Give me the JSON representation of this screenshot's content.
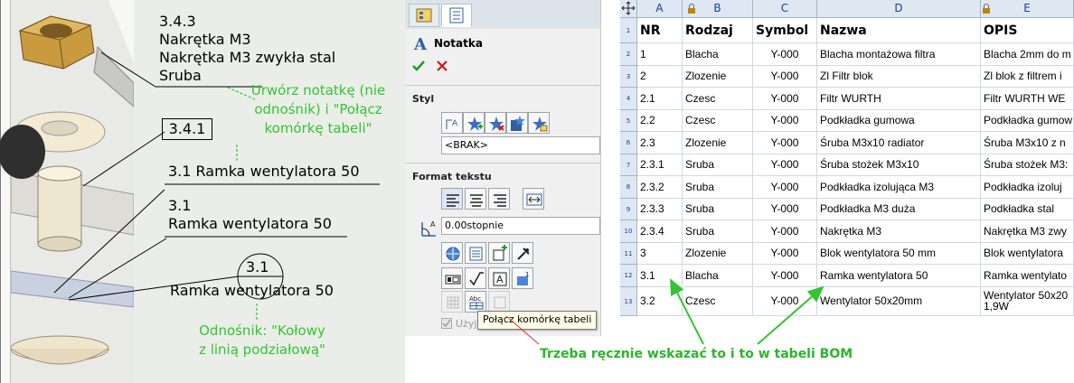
{
  "drawing": {
    "note1": {
      "line1": "3.4.3",
      "line2": "Nakrętka M3",
      "line3": "Nakrętka M3 zwykła stal",
      "line4": "Sruba"
    },
    "callout_note": {
      "line1": "Urwórz notatkę (nie",
      "line2": "odnośnik) i \"Połącz",
      "line3": "komórkę tabeli\""
    },
    "balloon_box": "3.4.1",
    "note2": "3.1  Ramka wentylatora 50",
    "note3": {
      "line1": "3.1",
      "line2": "Ramka wentylatora 50"
    },
    "balloon_circle": {
      "top": "3.1",
      "bottom": "Ramka wentylatora 50"
    },
    "callout_balloon": {
      "line1": "Odnośnik: \"Kołowy",
      "line2": "z linią podziałową\""
    }
  },
  "panel": {
    "title": "Notatka",
    "style_section": "Styl",
    "style_value": "<BRAK>",
    "text_format_section": "Format tekstu",
    "angle_value": "0.00stopnie",
    "checkbox_label": "Użyj czcionki dokumentu",
    "tooltip": "Połącz komórkę tabeli"
  },
  "sheet": {
    "columns": [
      "A",
      "B",
      "C",
      "D",
      "E"
    ],
    "header_row": [
      "NR",
      "Rodzaj",
      "Symbol",
      "Nazwa",
      "OPIS"
    ],
    "rows": [
      {
        "num": "2",
        "cells": [
          "1",
          "Blacha",
          "Y-000",
          "Blacha montażowa filtra",
          "Blacha 2mm do m"
        ]
      },
      {
        "num": "3",
        "cells": [
          "2",
          "Zlozenie",
          "Y-000",
          "Zl Filtr blok",
          "Zl blok z filtrem i"
        ]
      },
      {
        "num": "4",
        "cells": [
          "2.1",
          "Czesc",
          "Y-000",
          "Filtr WURTH",
          "Filtr WURTH WE"
        ]
      },
      {
        "num": "5",
        "cells": [
          "2.2",
          "Czesc",
          "Y-000",
          "Podkładka gumowa",
          "Podkładka gumow"
        ]
      },
      {
        "num": "6",
        "cells": [
          "2.3",
          "Zlozenie",
          "Y-000",
          "Śruba M3x10 radiator",
          "Śruba M3x10 z n"
        ]
      },
      {
        "num": "7",
        "cells": [
          "2.3.1",
          "Sruba",
          "Y-000",
          "Śruba stożek M3x10",
          "Śruba stożek M3:"
        ]
      },
      {
        "num": "8",
        "cells": [
          "2.3.2",
          "Sruba",
          "Y-000",
          "Podkładka izolująca M3",
          "Podkładka izoluj"
        ]
      },
      {
        "num": "9",
        "cells": [
          "2.3.3",
          "Sruba",
          "Y-000",
          "Podkładka M3 duża",
          "Podkładka stal"
        ]
      },
      {
        "num": "10",
        "cells": [
          "2.3.4",
          "Sruba",
          "Y-000",
          "Nakrętka M3",
          "Nakrętka M3 zwy"
        ]
      },
      {
        "num": "11",
        "cells": [
          "3",
          "Zlozenie",
          "Y-000",
          "Blok wentylatora 50 mm",
          "Blok wentylatora"
        ]
      },
      {
        "num": "12",
        "cells": [
          "3.1",
          "Blacha",
          "Y-000",
          "Ramka wentylatora 50",
          "Ramka wentylato"
        ]
      },
      {
        "num": "13",
        "cells": [
          "3.2",
          "Czesc",
          "Y-000",
          "Wentylator 50x20mm",
          "Wentylator 50x20 1,9W"
        ]
      }
    ]
  },
  "bottom_note": "Trzeba ręcznie wskazać to i to w tabeli BOM",
  "colors": {
    "green": "#33c433",
    "panel_bg": "#f0f0f0",
    "header_bg": "#dfe7f3",
    "grid": "#d0d7e5"
  }
}
